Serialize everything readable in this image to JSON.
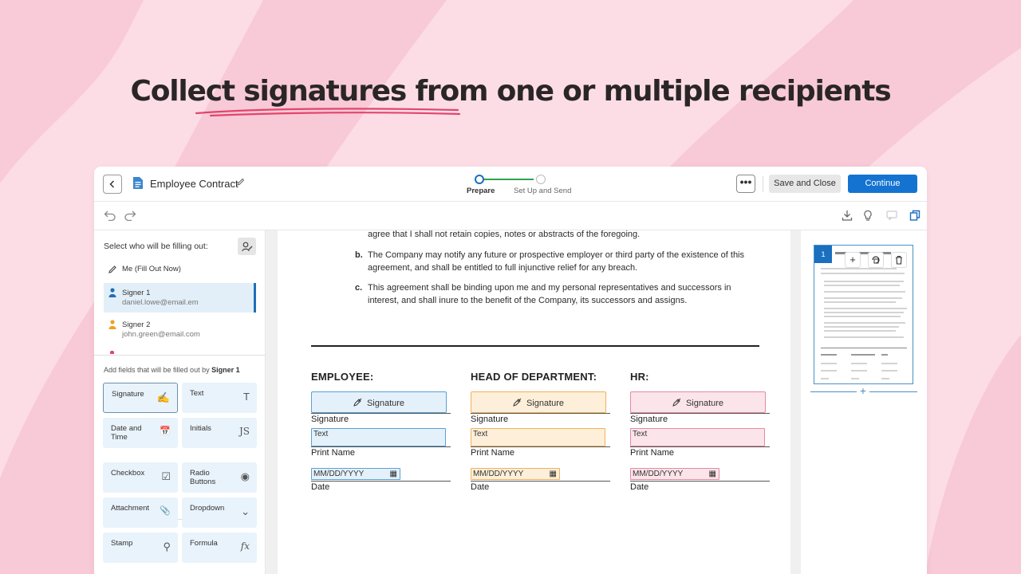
{
  "headline": "Collect signatures from one or multiple recipients",
  "colors": {
    "accent": "#1473d1",
    "highlight": "#e2456d",
    "background": "#fcdde6"
  },
  "topbar": {
    "doc_title": "Employee Contract",
    "steps": [
      {
        "label": "Prepare",
        "active": true
      },
      {
        "label": "Set Up and Send",
        "active": false
      }
    ],
    "more_label": "•••",
    "save_label": "Save and Close",
    "continue_label": "Continue"
  },
  "sidebar": {
    "title": "Select who will be filling out:",
    "me": "Me (Fill Out Now)",
    "signers": [
      {
        "name": "Signer 1",
        "email": "daniel.lowe@email.em",
        "color": "#1f6fb9"
      },
      {
        "name": "Signer 2",
        "email": "john.green@email.com",
        "color": "#f0a020"
      }
    ],
    "add_fields_prefix": "Add fields that will be filled out by ",
    "add_fields_signer": "Signer 1",
    "fields": [
      {
        "label": "Signature",
        "icon": "✍"
      },
      {
        "label": "Text",
        "icon": "T"
      },
      {
        "label": "Date and Time",
        "icon": "📅"
      },
      {
        "label": "Initials",
        "icon": "JS"
      },
      {
        "label": "Checkbox",
        "icon": "☑"
      },
      {
        "label": "Radio Buttons",
        "icon": "◉"
      },
      {
        "label": "Attachment",
        "icon": "📎"
      },
      {
        "label": "Dropdown",
        "icon": "⌄"
      },
      {
        "label": "Stamp",
        "icon": "⚲"
      },
      {
        "label": "Formula",
        "icon": "fx"
      }
    ]
  },
  "document": {
    "para_a_tail": "agree that I shall not retain copies, notes or abstracts of the foregoing.",
    "para_b_marker": "b.",
    "para_b": "The Company may notify any future or prospective employer or third party of the existence of this agreement, and shall be entitled to full injunctive relief for any breach.",
    "para_c_marker": "c.",
    "para_c": "This agreement shall be binding upon me and my personal representatives and successors in interest, and shall inure to the benefit of the Company, its successors and assigns.",
    "columns": [
      {
        "heading": "EMPLOYEE:",
        "sig_field": "Signature",
        "sig_label": "Signature",
        "text_field": "Text",
        "text_label": "Print Name",
        "date_field": "MM/DD/YYYY",
        "date_label": "Date"
      },
      {
        "heading": "HEAD OF DEPARTMENT:",
        "sig_field": "Signature",
        "sig_label": "Signature",
        "text_field": "Text",
        "text_label": "Print Name",
        "date_field": "MM/DD/YYYY",
        "date_label": "Date"
      },
      {
        "heading": "HR:",
        "sig_field": "Signature",
        "sig_label": "Signature",
        "text_field": "Text",
        "text_label": "Print Name",
        "date_field": "MM/DD/YYYY",
        "date_label": "Date"
      }
    ]
  },
  "thumbnails": {
    "page_number": "1",
    "add_icon": "+",
    "add_page": "+"
  }
}
